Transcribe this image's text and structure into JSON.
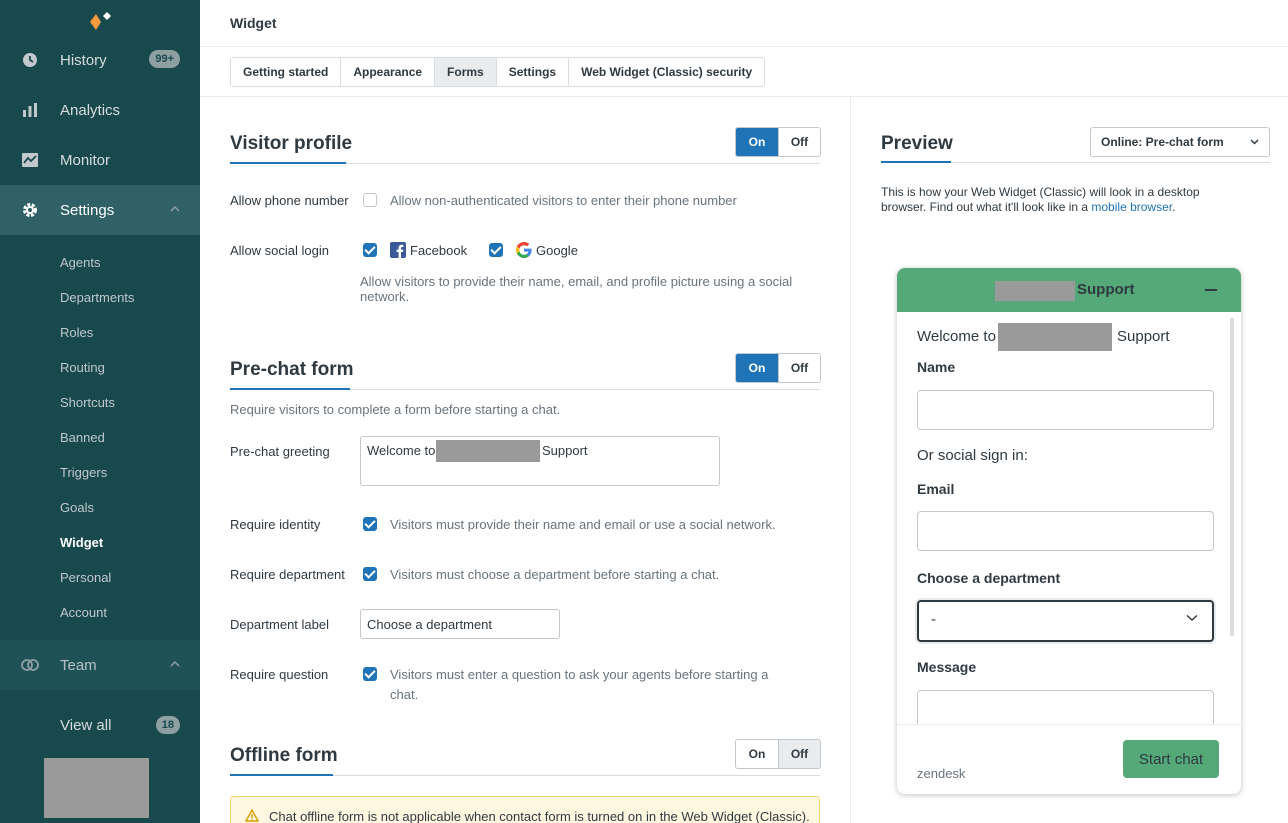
{
  "sidebar": {
    "history": {
      "label": "History",
      "badge": "99+"
    },
    "analytics": {
      "label": "Analytics"
    },
    "monitor": {
      "label": "Monitor"
    },
    "settings": {
      "label": "Settings"
    },
    "sub_items": [
      "Agents",
      "Departments",
      "Roles",
      "Routing",
      "Shortcuts",
      "Banned",
      "Triggers",
      "Goals",
      "Widget",
      "Personal",
      "Account"
    ],
    "active_sub": "Widget",
    "team": {
      "label": "Team"
    },
    "view_all": {
      "label": "View all",
      "badge": "18"
    }
  },
  "header": {
    "title": "Widget"
  },
  "tabs": [
    "Getting started",
    "Appearance",
    "Forms",
    "Settings",
    "Web Widget (Classic) security"
  ],
  "active_tab": "Forms",
  "visitor_profile": {
    "title": "Visitor profile",
    "toggle": {
      "on": "On",
      "off": "Off",
      "value": "On"
    },
    "phone_label": "Allow phone number",
    "phone_desc": "Allow non-authenticated visitors to enter their phone number",
    "social_label": "Allow social login",
    "facebook": "Facebook",
    "google": "Google",
    "social_desc_1": "Allow visitors to provide their name, email, and profile picture using a social",
    "social_desc_2": "network."
  },
  "prechat": {
    "title": "Pre-chat form",
    "toggle": {
      "on": "On",
      "off": "Off",
      "value": "On"
    },
    "desc": "Require visitors to complete a form before starting a chat.",
    "greeting_label": "Pre-chat greeting",
    "greeting_prefix": "Welcome to",
    "greeting_suffix": "Support",
    "identity_label": "Require identity",
    "identity_desc": "Visitors must provide their name and email or use a social network.",
    "department_label": "Require department",
    "department_desc": "Visitors must choose a department before starting a chat.",
    "dept_label_label": "Department label",
    "dept_label_value": "Choose a department",
    "question_label": "Require question",
    "question_desc_1": "Visitors must enter a question to ask your agents before starting a",
    "question_desc_2": "chat."
  },
  "offline": {
    "title": "Offline form",
    "toggle": {
      "on": "On",
      "off": "Off",
      "value": "Off"
    },
    "warning": "Chat offline form is not applicable when contact form is turned on in the Web Widget (Classic)."
  },
  "preview": {
    "title": "Preview",
    "select_value": "Online: Pre-chat form",
    "desc_1": "This is how your Web Widget (Classic) will look in a desktop browser. Find out what it'll look like in a ",
    "desc_link": "mobile browser",
    "desc_end": "."
  },
  "widget": {
    "header_suffix": "Support",
    "welcome_prefix": "Welcome to",
    "welcome_suffix": "Support",
    "name_label": "Name",
    "social_signin": "Or social sign in:",
    "email_label": "Email",
    "dept_label": "Choose a department",
    "dept_value": "-",
    "message_label": "Message",
    "brand": "zendesk",
    "start_button": "Start chat"
  },
  "colors": {
    "sidebar": "#17494d",
    "accent": "#1f73b7",
    "widget_green": "#55a877"
  }
}
